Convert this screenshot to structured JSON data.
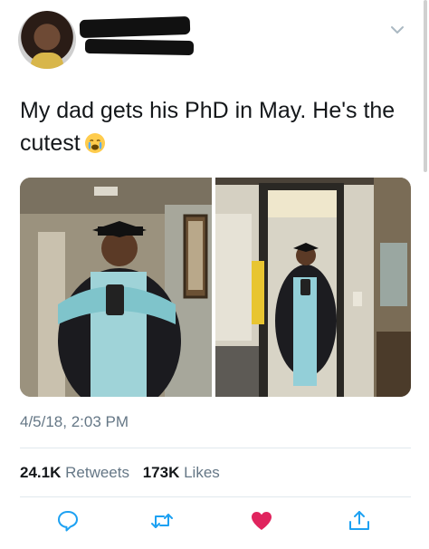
{
  "tweet": {
    "text_line1": "My dad gets his PhD in May. He's the",
    "text_line2": "cutest",
    "emoji": "crying-face-emoji",
    "timestamp": "4/5/18, 2:03 PM"
  },
  "stats": {
    "retweets_count": "24.1K",
    "retweets_label": "Retweets",
    "likes_count": "173K",
    "likes_label": "Likes"
  },
  "actions": {
    "reply_icon": "reply-icon",
    "retweet_icon": "retweet-icon",
    "like_icon": "heart-icon",
    "share_icon": "share-icon"
  },
  "colors": {
    "text": "#14171a",
    "secondary": "#657786",
    "like_active": "#e0245e",
    "action_icon": "#1da1f2"
  }
}
